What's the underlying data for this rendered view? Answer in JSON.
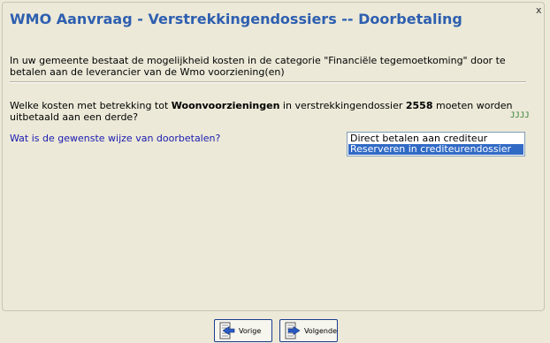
{
  "header": {
    "title": "WMO Aanvraag - Verstrekkingendossiers -- Doorbetaling",
    "close_glyph": "x"
  },
  "intro": {
    "text": "In uw gemeente bestaat de mogelijkheid kosten in de categorie \"Financiële tegemoetkoming\" door te betalen aan de leverancier van de Wmo voorziening(en)"
  },
  "question": {
    "part1": "Welke kosten met betrekking tot ",
    "category": "Woonvoorzieningen",
    "part2": " in verstrekkingendossier ",
    "dossier_number": "2558",
    "part3": " moeten worden uitbetaald aan een derde?",
    "marker": "JJJJ"
  },
  "payment_method": {
    "label": "Wat is de gewenste wijze van doorbetalen?",
    "options": [
      {
        "label": "Direct betalen aan crediteur",
        "selected": false
      },
      {
        "label": "Reserveren in crediteurendossier",
        "selected": true
      }
    ]
  },
  "footer": {
    "prev_label": "Vorige",
    "next_label": "Volgende"
  },
  "colors": {
    "title": "#2e5fb0",
    "link_text": "#1a1ab0",
    "selection": "#316ac5",
    "background": "#ece9d8"
  }
}
